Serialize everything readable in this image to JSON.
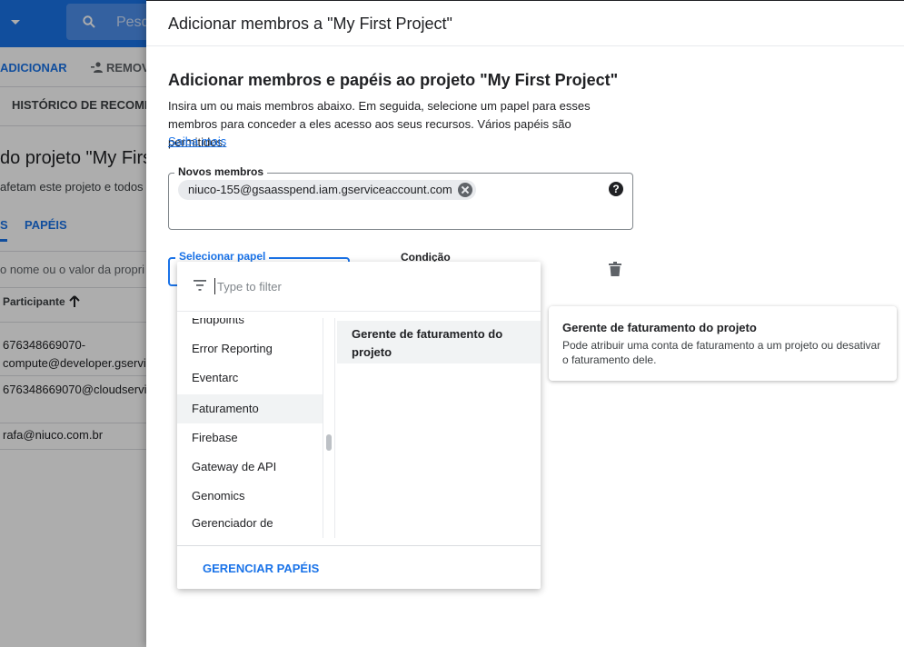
{
  "background": {
    "search_placeholder": "Pesq",
    "add_label": "ADICIONAR",
    "remove_label": "REMOV",
    "history_tab": "HISTÓRICO DE RECOMEN",
    "page_title": "do projeto \"My Firs",
    "description": "afetam este projeto e todos o",
    "tab_members": "S",
    "tab_roles": "PAPÉIS",
    "filter_placeholder": "o nome ou o valor da propri",
    "column_header": "Participante",
    "rows": [
      {
        "line1": "676348669070-",
        "line2": "compute@developer.gservic"
      },
      {
        "line1": "676348669070@cloudservic"
      },
      {
        "line1": "rafa@niuco.com.br"
      }
    ]
  },
  "panel": {
    "title": "Adicionar membros a \"My First Project\"",
    "section_title": "Adicionar membros e papéis ao projeto \"My First Project\"",
    "intro": "Insira um ou mais membros abaixo. Em seguida, selecione um papel para esses membros para conceder a eles acesso aos seus recursos. Vários papéis são permitidos.",
    "learn_more": "Saiba mais",
    "members_label": "Novos membros",
    "member_chip": "niuco-155@gsaasspend.iam.gserviceaccount.com",
    "help_glyph": "?",
    "role_label": "Selecionar papel",
    "condition_label": "Condição"
  },
  "dropdown": {
    "filter_placeholder": "Type to filter",
    "categories": [
      "Endpoints",
      "Error Reporting",
      "Eventarc",
      "Faturamento",
      "Firebase",
      "Gateway de API",
      "Genomics",
      "Gerenciador de"
    ],
    "selected_category": "Faturamento",
    "role": "Gerente de faturamento do projeto",
    "manage_roles": "GERENCIAR PAPÉIS"
  },
  "tooltip": {
    "title": "Gerente de faturamento do projeto",
    "text": "Pode atribuir uma conta de faturamento a um projeto ou desativar o faturamento dele."
  },
  "colors": {
    "accent": "#1a73e8",
    "scrim": "rgba(0,0,0,0.32)",
    "selected_row": "#f1f3f4"
  }
}
